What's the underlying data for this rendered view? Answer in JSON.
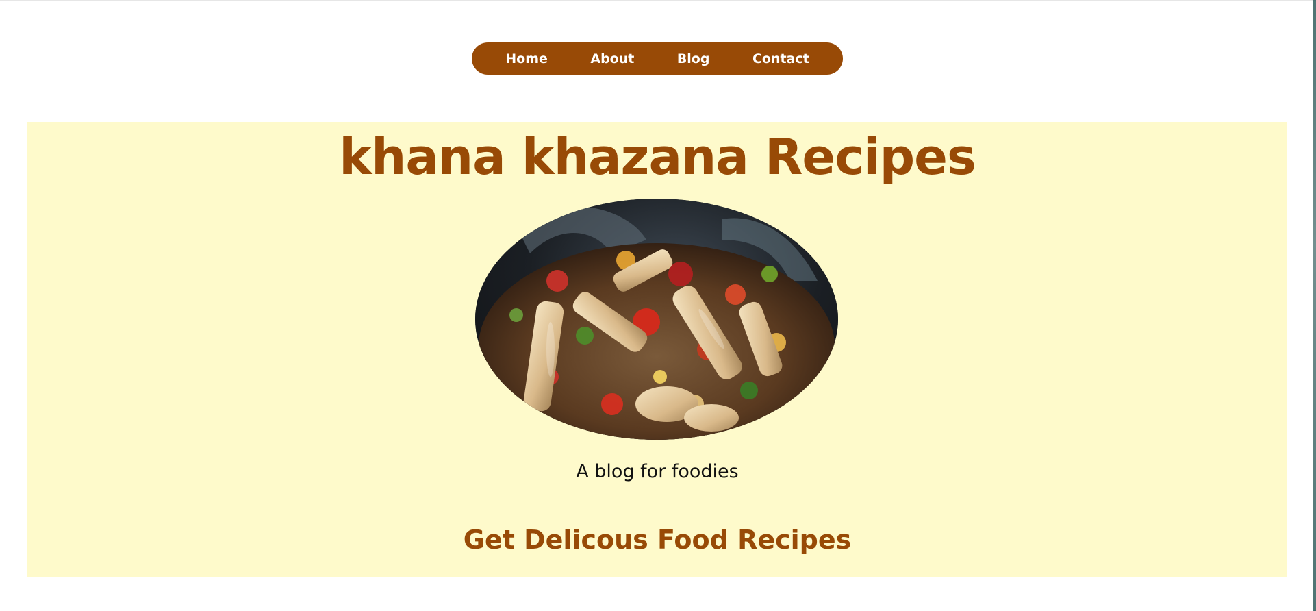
{
  "nav": {
    "items": [
      {
        "label": "Home"
      },
      {
        "label": "About"
      },
      {
        "label": "Blog"
      },
      {
        "label": "Contact"
      }
    ],
    "background_color": "#984a06",
    "text_color": "#ffffff"
  },
  "hero": {
    "title": "khana khazana Recipes",
    "tagline": "A blog for foodies",
    "subheading": "Get Delicous Food Recipes",
    "background_color": "#fefacb",
    "accent_color": "#984a06"
  }
}
